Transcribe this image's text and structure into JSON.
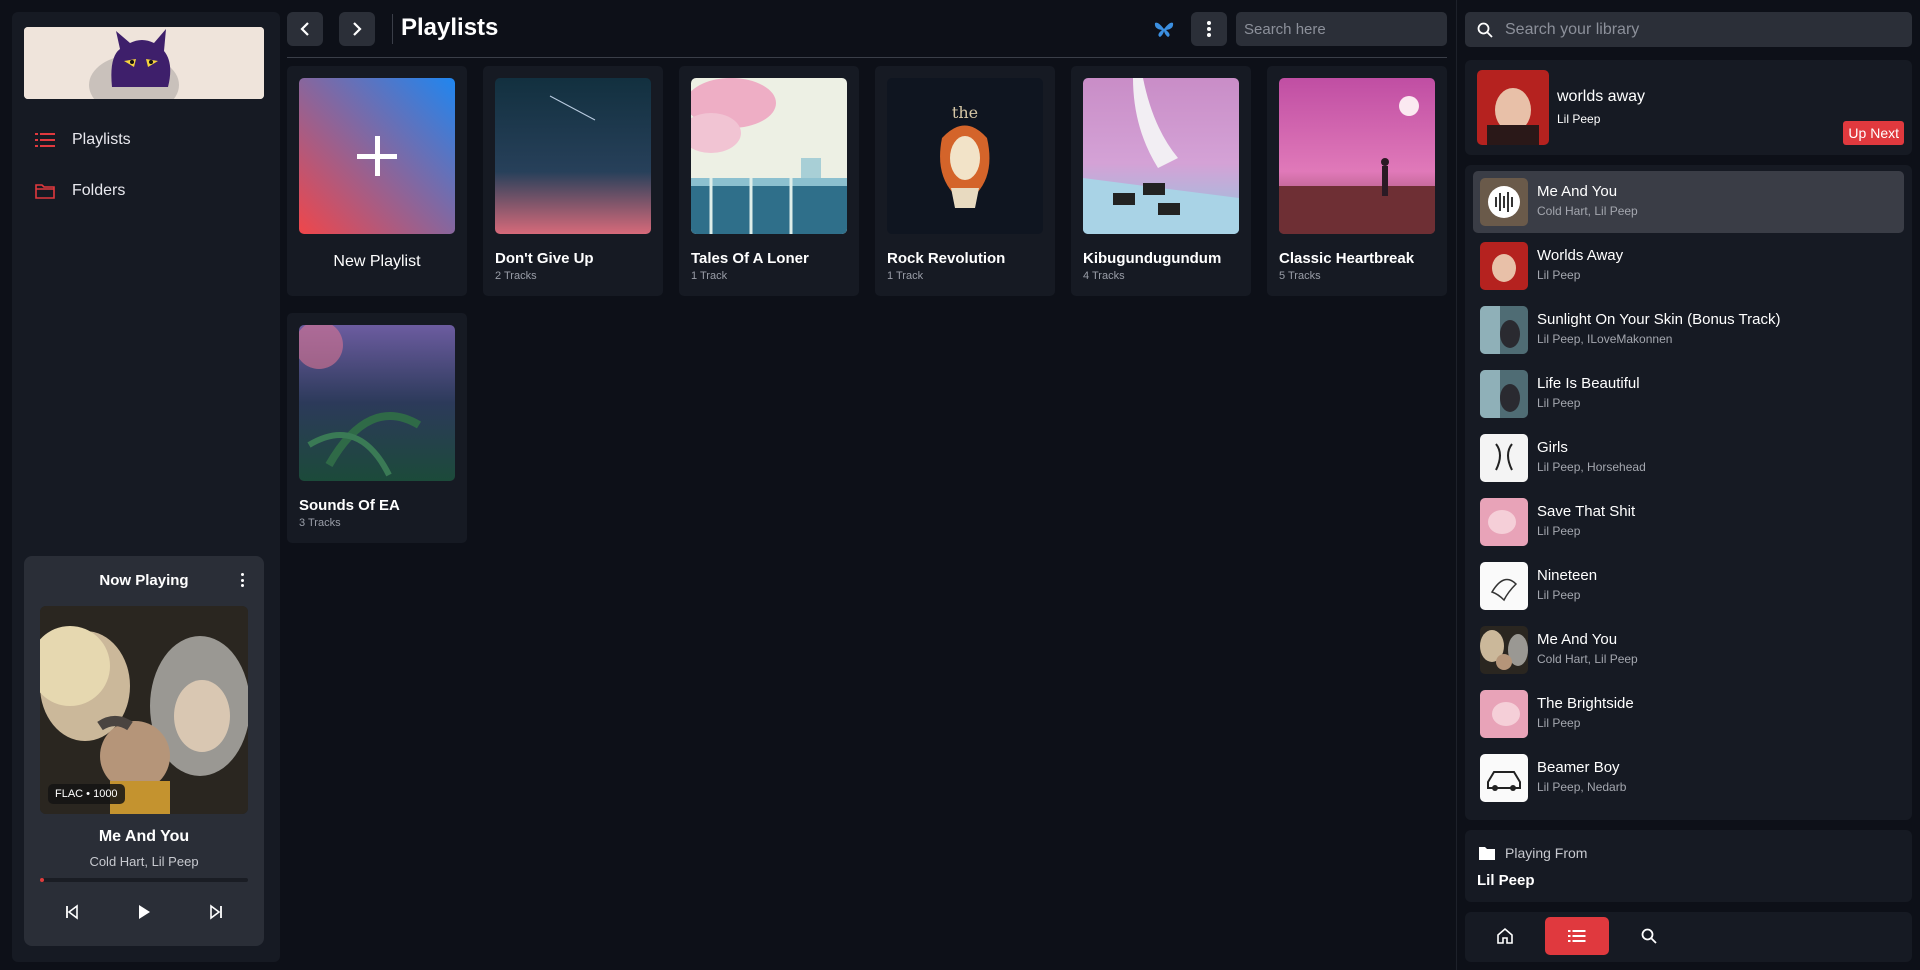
{
  "sidebar": {
    "nav": [
      {
        "label": "Playlists",
        "icon": "list-icon"
      },
      {
        "label": "Folders",
        "icon": "folder-icon"
      }
    ],
    "now_playing": {
      "title": "Now Playing",
      "badge": "FLAC • 1000",
      "song": "Me And You",
      "artist": "Cold Hart, Lil Peep",
      "progress": 0.02
    }
  },
  "header": {
    "title": "Playlists",
    "search_placeholder": "Search here"
  },
  "playlists": [
    {
      "name": "New Playlist",
      "count": ""
    },
    {
      "name": "Don't Give Up",
      "count": "2 Tracks"
    },
    {
      "name": "Tales Of A Loner",
      "count": "1 Track"
    },
    {
      "name": "Rock Revolution",
      "count": "1 Track"
    },
    {
      "name": "Kibugundugundum",
      "count": "4 Tracks"
    },
    {
      "name": "Classic Heartbreak",
      "count": "5 Tracks"
    },
    {
      "name": "Sounds Of EA",
      "count": "3 Tracks"
    }
  ],
  "right": {
    "search_placeholder": "Search your library",
    "current": {
      "title": "worlds away",
      "artist": "Lil Peep",
      "up_next_label": "Up Next"
    },
    "queue": [
      {
        "title": "Me And You",
        "artist": "Cold Hart, Lil Peep"
      },
      {
        "title": "Worlds Away",
        "artist": "Lil Peep"
      },
      {
        "title": "Sunlight On Your Skin (Bonus Track)",
        "artist": "Lil Peep, ILoveMakonnen"
      },
      {
        "title": "Life Is Beautiful",
        "artist": "Lil Peep"
      },
      {
        "title": "Girls",
        "artist": "Lil Peep, Horsehead"
      },
      {
        "title": "Save That Shit",
        "artist": "Lil Peep"
      },
      {
        "title": "Nineteen",
        "artist": "Lil Peep"
      },
      {
        "title": "Me And You",
        "artist": "Cold Hart, Lil Peep"
      },
      {
        "title": "The Brightside",
        "artist": "Lil Peep"
      },
      {
        "title": "Beamer Boy",
        "artist": "Lil Peep, Nedarb"
      }
    ],
    "playing_from": {
      "label": "Playing From",
      "value": "Lil Peep"
    }
  },
  "colors": {
    "accent": "#e0393e",
    "background": "#0d1018",
    "panel": "#161a23",
    "butterfly": "#3b8fe0"
  }
}
